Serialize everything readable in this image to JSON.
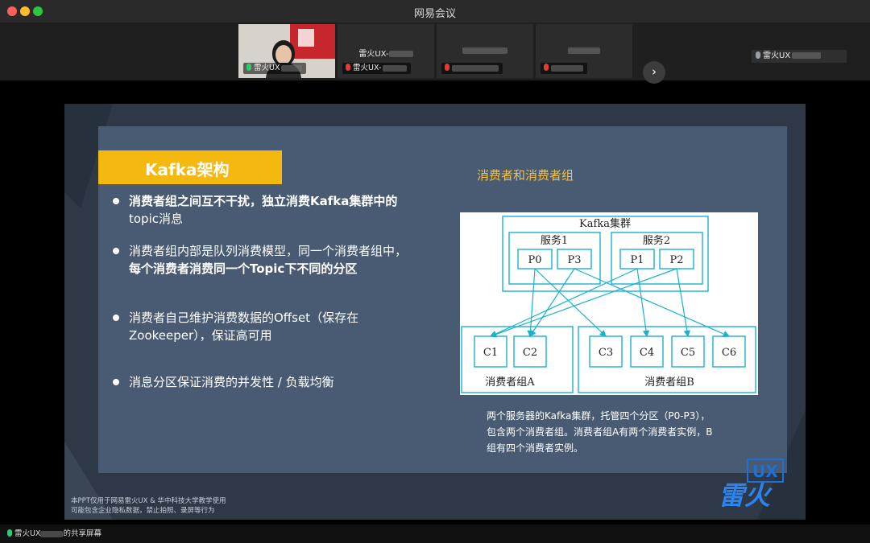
{
  "window": {
    "title": "网易会议",
    "traffic_lights": [
      {
        "name": "close",
        "color": "#ff5f57"
      },
      {
        "name": "minimize",
        "color": "#febc2e"
      },
      {
        "name": "maximize",
        "color": "#28c840"
      }
    ]
  },
  "participants": [
    {
      "label": "雷火UX",
      "mic": "on",
      "video": "on"
    },
    {
      "label": "雷火UX-",
      "name": "雷火UX-",
      "mic": "muted",
      "video": "off"
    },
    {
      "label": "",
      "name": "",
      "mic": "muted",
      "video": "off"
    },
    {
      "label": "",
      "name": "",
      "mic": "muted",
      "video": "off"
    }
  ],
  "speaker": {
    "label": "雷火UX"
  },
  "slide": {
    "heading": "Kafka架构",
    "subtitle": "消费者和消费者组",
    "bullets": [
      {
        "line1": "消费者组之间互不干扰，独立消费Kafka集群中的",
        "line2": "topic消息"
      },
      {
        "line1": "消费者组内部是队列消费模型，同一个消费者组中，",
        "line2": "每个消费者消费同一个Topic下不同的分区"
      },
      {
        "line1": "消费者自己维护消费数据的Offset（保存在",
        "line2": "Zookeeper），保证高可用"
      },
      {
        "line1": "消息分区保证消费的并发性 / 负载均衡",
        "line2": ""
      }
    ],
    "diagram": {
      "cluster_label": "Kafka集群",
      "servers": [
        {
          "label": "服务1",
          "partitions": [
            "P0",
            "P3"
          ]
        },
        {
          "label": "服务2",
          "partitions": [
            "P1",
            "P2"
          ]
        }
      ],
      "consumer_groups": [
        {
          "label": "消费者组A",
          "consumers": [
            "C1",
            "C2"
          ]
        },
        {
          "label": "消费者组B",
          "consumers": [
            "C3",
            "C4",
            "C5",
            "C6"
          ]
        }
      ],
      "assignments": [
        {
          "partition": "P0",
          "consumer": "C2"
        },
        {
          "partition": "P0",
          "consumer": "C3"
        },
        {
          "partition": "P3",
          "consumer": "C2"
        },
        {
          "partition": "P3",
          "consumer": "C6"
        },
        {
          "partition": "P1",
          "consumer": "C1"
        },
        {
          "partition": "P1",
          "consumer": "C4"
        },
        {
          "partition": "P2",
          "consumer": "C1"
        },
        {
          "partition": "P2",
          "consumer": "C5"
        }
      ],
      "color": "#1ab0cf"
    },
    "caption": {
      "line1": "两个服务器的Kafka集群，托管四个分区（P0-P3），",
      "line2": "包含两个消费者组。消费者组A有两个消费者实例，B",
      "line3": "组有四个消费者实例。"
    },
    "watermark": {
      "line1": "本PPT仅用于网易雷火UX & 华中科技大学教学使用",
      "line2": "可能包含企业隐私数据，禁止拍照、录屏等行为"
    },
    "logo": {
      "text_top": "UX",
      "text_main": "雷火"
    }
  },
  "bottom_bar": {
    "sharer": "雷火UX",
    "suffix": "的共享屏幕"
  },
  "colors": {
    "accent_yellow": "#f5b80f",
    "slide_bg": "#485b73",
    "diagram_cyan": "#1ab0cf",
    "mic_on": "#2ecc71",
    "mic_muted": "#e53935"
  }
}
